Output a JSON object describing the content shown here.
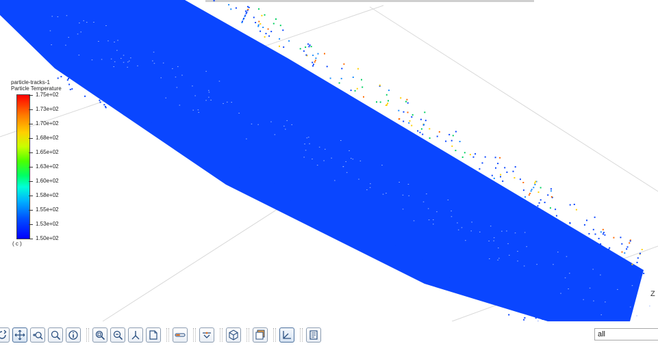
{
  "legend": {
    "title": "particle-tracks-1",
    "subtitle": "Particle Temperature",
    "ticks": [
      "1.75e+02",
      "1.73e+02",
      "1.70e+02",
      "1.68e+02",
      "1.65e+02",
      "1.63e+02",
      "1.60e+02",
      "1.58e+02",
      "1.55e+02",
      "1.53e+02",
      "1.50e+02"
    ],
    "unit": "( c )"
  },
  "axis_label": "Z",
  "toolbar": {
    "buttons": [
      {
        "name": "rotate-button",
        "icon": "rotate-icon"
      },
      {
        "name": "pan-button",
        "icon": "pan-icon",
        "active": true
      },
      {
        "name": "zoom-in-out-button",
        "icon": "zoom-icon"
      },
      {
        "name": "zoom-to-area-button",
        "icon": "magnifier-icon"
      },
      {
        "name": "probe-button",
        "icon": "info-icon"
      },
      {
        "name": "fit-to-window-button",
        "icon": "fit-icon"
      },
      {
        "name": "zoom-out-button",
        "icon": "zoom-out-icon"
      },
      {
        "name": "axes-orientation-button",
        "icon": "axes-icon"
      },
      {
        "name": "page-view-button",
        "icon": "page-icon"
      },
      {
        "name": "clipping-button",
        "icon": "slider-icon"
      },
      {
        "name": "views-button",
        "icon": "camera-icon"
      },
      {
        "name": "cube-view-button",
        "icon": "cube-icon"
      },
      {
        "name": "layout-button",
        "icon": "window-icon"
      },
      {
        "name": "axis-triad-button",
        "icon": "triad-icon",
        "active": true
      },
      {
        "name": "notes-button",
        "icon": "notes-icon"
      }
    ]
  },
  "filter": {
    "value": "all"
  },
  "colors": {
    "particle_blue": "#0a46ff",
    "accent": "#4a6f9c"
  }
}
